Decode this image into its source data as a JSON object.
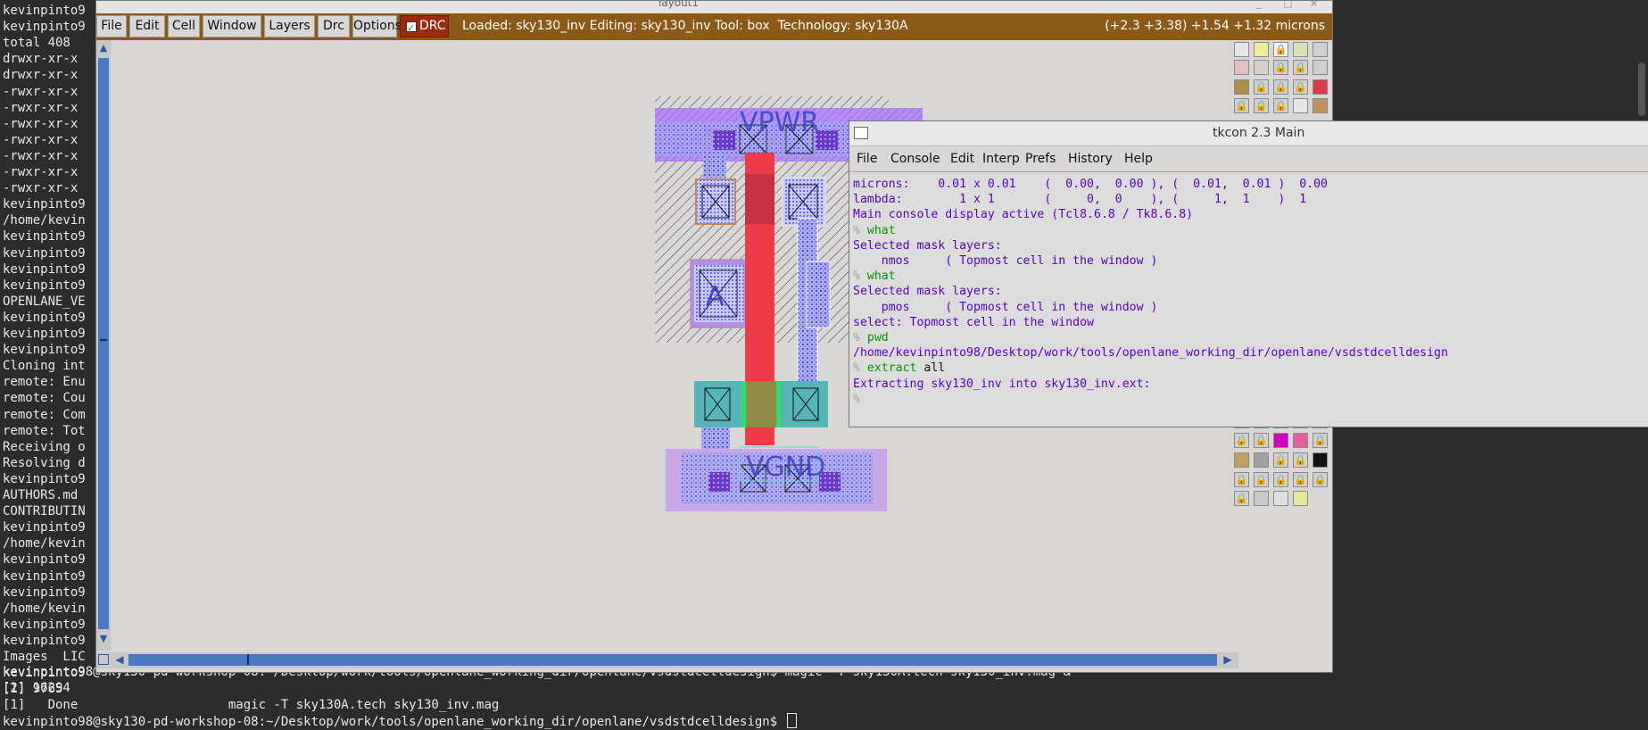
{
  "colors": {
    "terminal_bg": "#2c2c2c",
    "magic_menubar": "#8b5a16",
    "drc_button": "#9b2b0d",
    "console_output": "#5a00c9",
    "console_command": "#009600",
    "nwell_purple": "#b38ef0",
    "poly_red": "#ee3b48",
    "diffusion_teal": "#56b5b6",
    "metal_blue": "#7a7ef0"
  },
  "terminal": {
    "lines": [
      "kevinpinto9",
      "kevinpinto9",
      "total 408",
      "drwxr-xr-x",
      "drwxr-xr-x",
      "-rwxr-xr-x",
      "-rwxr-xr-x",
      "-rwxr-xr-x",
      "-rwxr-xr-x",
      "-rwxr-xr-x",
      "-rwxr-xr-x",
      "-rwxr-xr-x",
      "kevinpinto9",
      "/home/kevin",
      "kevinpinto9",
      "kevinpinto9",
      "kevinpinto9",
      "kevinpinto9",
      "OPENLANE_VE",
      "kevinpinto9",
      "kevinpinto9",
      "kevinpinto9",
      "Cloning int",
      "remote: Enu",
      "remote: Cou",
      "remote: Com",
      "remote: Tot",
      "Receiving o",
      "Resolving d",
      "kevinpinto9",
      "AUTHORS.md",
      "CONTRIBUTIN",
      "kevinpinto9",
      "/home/kevin",
      "kevinpinto9",
      "kevinpinto9",
      "kevinpinto9",
      "/home/kevin",
      "kevinpinto9",
      "kevinpinto9",
      "Images  LIC",
      "kevinpinto9",
      "[1] 9765"
    ],
    "bottom_lines": [
      "kevinpinto98@sky130-pd-workshop-08:~/Desktop/work/tools/openlane_working_dir/openlane/vsdstdcelldesign$ magic -T sky130A.tech sky130_inv.mag &",
      "[2] 16294",
      "[1]   Done                    magic -T sky130A.tech sky130_inv.mag",
      "kevinpinto98@sky130-pd-workshop-08:~/Desktop/work/tools/openlane_working_dir/openlane/vsdstdcelldesign$ "
    ]
  },
  "magic": {
    "window_title": "layout1",
    "menu": [
      "File",
      "Edit",
      "Cell",
      "Window",
      "Layers",
      "Drc",
      "Options"
    ],
    "drc_label": "DRC",
    "status": "Loaded: sky130_inv Editing: sky130_inv Tool: box  Technology: sky130A",
    "coords": "(+2.3 +3.38) +1.54 +1.32 microns",
    "labels": {
      "vpwr": "VPWR",
      "vgnd": "VGND",
      "input": "A"
    }
  },
  "tkcon": {
    "title": "tkcon 2.3 Main",
    "menu": [
      "File",
      "Console",
      "Edit",
      "Interp",
      "Prefs",
      "History",
      "Help"
    ],
    "prompt": "%",
    "lines": [
      {
        "kind": "out",
        "text": "microns:    0.01 x 0.01    (  0.00,  0.00 ), (  0.01,  0.01 )  0.00"
      },
      {
        "kind": "out",
        "text": "lambda:        1 x 1       (     0,  0    ), (     1,  1    )  1"
      },
      {
        "kind": "out",
        "text": "Main console display active (Tcl8.6.8 / Tk8.6.8)"
      },
      {
        "kind": "cmd",
        "cmd": "what",
        "arg": ""
      },
      {
        "kind": "out",
        "text": "Selected mask layers:"
      },
      {
        "kind": "out",
        "text": "    nmos     ( Topmost cell in the window )"
      },
      {
        "kind": "cmd",
        "cmd": "what",
        "arg": ""
      },
      {
        "kind": "out",
        "text": "Selected mask layers:"
      },
      {
        "kind": "out",
        "text": "    pmos     ( Topmost cell in the window )"
      },
      {
        "kind": "out",
        "text": "select: Topmost cell in the window"
      },
      {
        "kind": "cmd",
        "cmd": "pwd",
        "arg": ""
      },
      {
        "kind": "out",
        "text": "/home/kevinpinto98/Desktop/work/tools/openlane_working_dir/openlane/vsdstdcelldesign"
      },
      {
        "kind": "cmd",
        "cmd": "extract",
        "arg": " all"
      },
      {
        "kind": "out",
        "text": "Extracting sky130_inv into sky130_inv.ext:"
      },
      {
        "kind": "prompt",
        "text": ""
      }
    ]
  }
}
